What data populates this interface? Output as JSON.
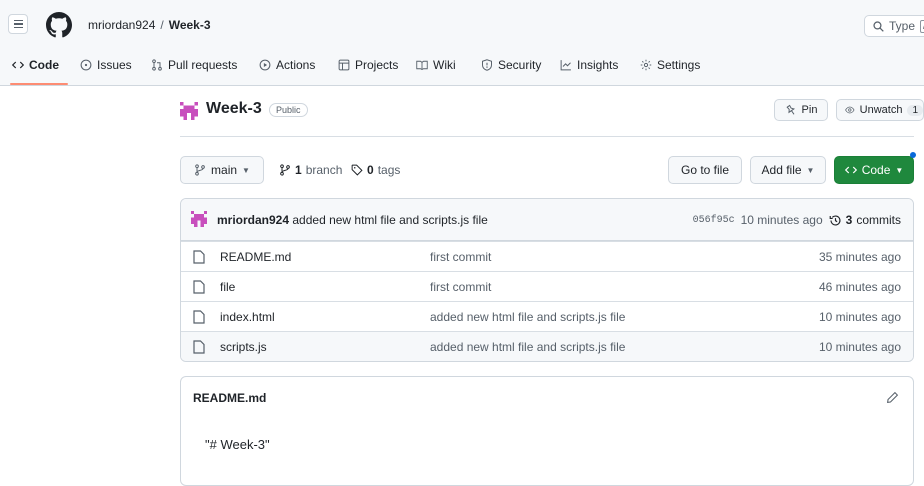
{
  "header": {
    "owner": "mriordan924",
    "separator": "/",
    "repo": "Week-3",
    "search_label": "Type",
    "search_kbd": "/"
  },
  "tabs": [
    {
      "label": "Code",
      "icon": "code-icon"
    },
    {
      "label": "Issues",
      "icon": "issue-icon"
    },
    {
      "label": "Pull requests",
      "icon": "pull-request-icon"
    },
    {
      "label": "Actions",
      "icon": "play-icon"
    },
    {
      "label": "Projects",
      "icon": "table-icon"
    },
    {
      "label": "Wiki",
      "icon": "book-icon"
    },
    {
      "label": "Security",
      "icon": "shield-icon"
    },
    {
      "label": "Insights",
      "icon": "graph-icon"
    },
    {
      "label": "Settings",
      "icon": "gear-icon"
    }
  ],
  "repo": {
    "name": "Week-3",
    "visibility": "Public",
    "pin_label": "Pin",
    "watch_label": "Unwatch",
    "watch_count": "1"
  },
  "branch_bar": {
    "branch": "main",
    "branch_count": "1",
    "branch_word": "branch",
    "tag_count": "0",
    "tag_word": "tags",
    "go_to_file": "Go to file",
    "add_file": "Add file",
    "code": "Code"
  },
  "latest_commit": {
    "author": "mriordan924",
    "message": "added new html file and scripts.js file",
    "sha": "056f95c",
    "time": "10 minutes ago",
    "count": "3",
    "count_word": "commits"
  },
  "files": [
    {
      "name": "README.md",
      "commit": "first commit",
      "age": "35 minutes ago"
    },
    {
      "name": "file",
      "commit": "first commit",
      "age": "46 minutes ago"
    },
    {
      "name": "index.html",
      "commit": "added new html file and scripts.js file",
      "age": "10 minutes ago"
    },
    {
      "name": "scripts.js",
      "commit": "added new html file and scripts.js file",
      "age": "10 minutes ago"
    }
  ],
  "readme": {
    "title": "README.md",
    "body": "\"# Week-3\""
  },
  "colors": {
    "accent_green": "#1f883d",
    "tab_underline": "#fd8c73",
    "avatar_pink": "#c84fbd"
  }
}
